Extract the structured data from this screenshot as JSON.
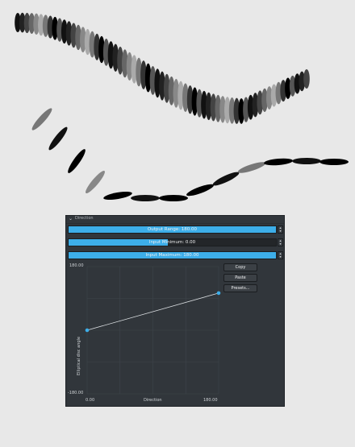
{
  "panel": {
    "title": "Direction",
    "output_range": {
      "label": "Output Range: 180.00",
      "fill": 1.0
    },
    "input_minimum": {
      "label": "Input Minimum: 0.00",
      "fill": 0.48
    },
    "input_maximum": {
      "label": "Input Maximum: 180.00",
      "fill": 1.0
    },
    "spin_up": "▴",
    "spin_down": "▾"
  },
  "curve": {
    "y_top": "180.00",
    "y_bottom": "-180.00",
    "x_left": "0.00",
    "x_right": "180.00",
    "x_axis_label": "Direction",
    "y_axis_label": "Elliptical disc angle",
    "points": [
      {
        "direction": 0,
        "angle": 0
      },
      {
        "direction": 180,
        "angle": 105
      }
    ]
  },
  "buttons": {
    "copy": "Copy",
    "paste": "Paste",
    "presets": "Presets..."
  },
  "colors": {
    "accent": "#3daee9",
    "panel_bg": "#31363b",
    "canvas_bg": "#e8e8e8"
  }
}
